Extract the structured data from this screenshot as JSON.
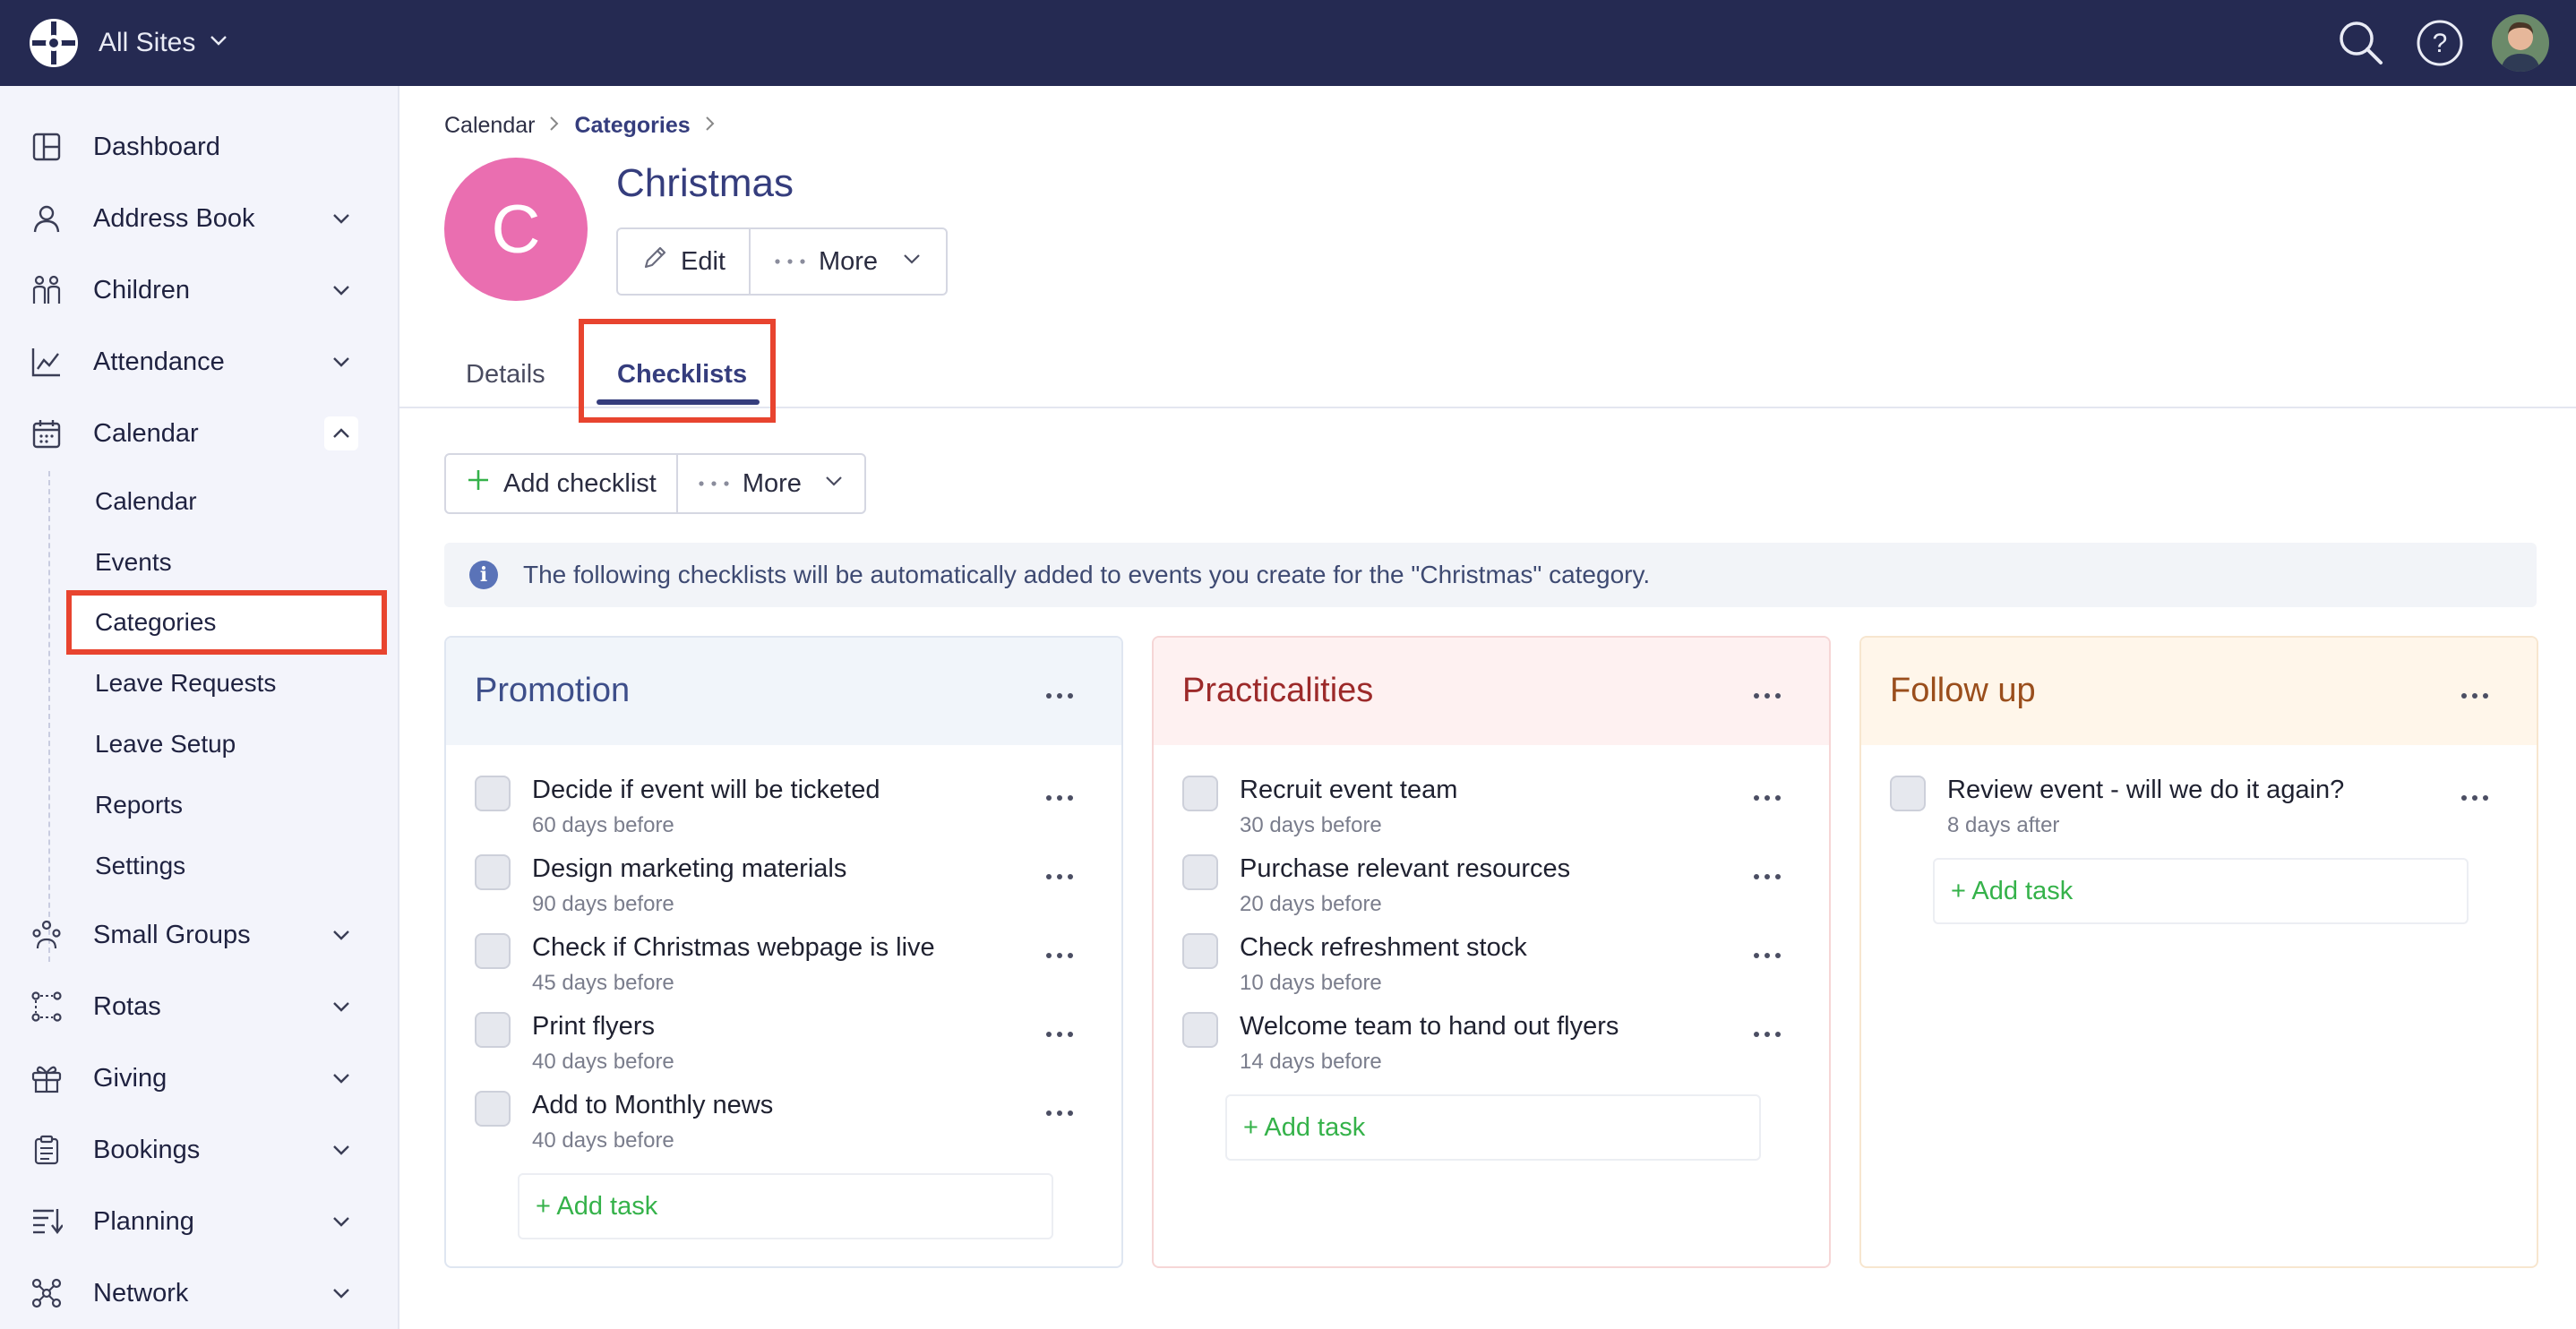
{
  "topbar": {
    "site_switch_label": "All Sites"
  },
  "sidebar": {
    "items": [
      {
        "label": "Dashboard",
        "icon": "dashboard-icon"
      },
      {
        "label": "Address Book",
        "icon": "person-icon"
      },
      {
        "label": "Children",
        "icon": "children-icon"
      },
      {
        "label": "Attendance",
        "icon": "chart-icon"
      },
      {
        "label": "Calendar",
        "icon": "calendar-icon"
      },
      {
        "label": "Small Groups",
        "icon": "group-icon"
      },
      {
        "label": "Rotas",
        "icon": "rotas-icon"
      },
      {
        "label": "Giving",
        "icon": "gift-icon"
      },
      {
        "label": "Bookings",
        "icon": "clipboard-icon"
      },
      {
        "label": "Planning",
        "icon": "planning-icon"
      },
      {
        "label": "Network",
        "icon": "network-icon"
      }
    ],
    "calendar_sub": [
      "Calendar",
      "Events",
      "Categories",
      "Leave Requests",
      "Leave Setup",
      "Reports",
      "Settings"
    ]
  },
  "breadcrumb": {
    "root": "Calendar",
    "current": "Categories"
  },
  "category": {
    "initial": "C",
    "title": "Christmas",
    "avatar_color": "#ea6eb0",
    "edit_label": "Edit",
    "more_label": "More"
  },
  "tabs": {
    "details": "Details",
    "checklists": "Checklists"
  },
  "toolbar": {
    "add_checklist": "Add checklist",
    "more": "More"
  },
  "info": {
    "text": "The following checklists will be automatically added to events you create for the \"Christmas\" category."
  },
  "checklists": [
    {
      "title": "Promotion",
      "tasks": [
        {
          "name": "Decide if event will be ticketed",
          "when": "60 days before"
        },
        {
          "name": "Design marketing materials",
          "when": "90 days before"
        },
        {
          "name": "Check if Christmas webpage is live",
          "when": "45 days before"
        },
        {
          "name": "Print flyers",
          "when": "40 days before"
        },
        {
          "name": "Add to Monthly news",
          "when": "40 days before"
        }
      ],
      "add_task": "+ Add task"
    },
    {
      "title": "Practicalities",
      "tasks": [
        {
          "name": "Recruit event team",
          "when": "30 days before"
        },
        {
          "name": "Purchase relevant resources",
          "when": "20 days before"
        },
        {
          "name": "Check refreshment stock",
          "when": "10 days before"
        },
        {
          "name": "Welcome team to hand out flyers",
          "when": "14 days before"
        }
      ],
      "add_task": "+ Add task"
    },
    {
      "title": "Follow up",
      "tasks": [
        {
          "name": "Review event - will we do it again?",
          "when": "8 days after"
        }
      ],
      "add_task": "+ Add task"
    }
  ],
  "colors": {
    "topbar": "#252a52",
    "accent": "#353d7d",
    "highlight": "#e8442f",
    "add_task": "#35b24a"
  }
}
